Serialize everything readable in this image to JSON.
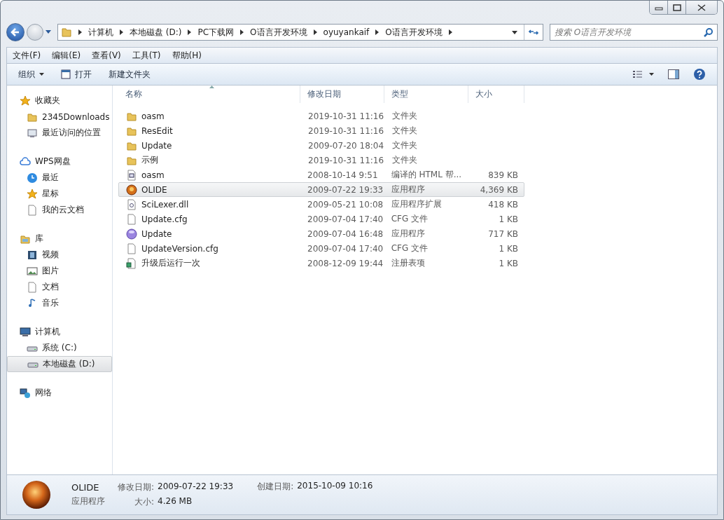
{
  "address_bar": {
    "breadcrumbs": [
      "计算机",
      "本地磁盘 (D:)",
      "PC下载网",
      "O语言开发环境",
      "oyuyankaif",
      "O语言开发环境"
    ]
  },
  "search": {
    "placeholder": "搜索 O语言开发环境"
  },
  "menu_bar": [
    "文件(F)",
    "编辑(E)",
    "查看(V)",
    "工具(T)",
    "帮助(H)"
  ],
  "toolbar": [
    {
      "kind": "dropdown",
      "label": "组织"
    },
    {
      "kind": "open",
      "label": "打开"
    },
    {
      "kind": "plain",
      "label": "新建文件夹"
    }
  ],
  "sidebar": {
    "groups": [
      {
        "label": "收藏夹",
        "kind": "star",
        "items": [
          {
            "label": "2345Downloads",
            "kind": "folder",
            "selected": false
          },
          {
            "label": "最近访问的位置",
            "kind": "recent",
            "selected": false
          }
        ]
      },
      {
        "label": "WPS网盘",
        "kind": "cloud",
        "items": [
          {
            "label": "最近",
            "kind": "clock",
            "selected": false
          },
          {
            "label": "星标",
            "kind": "star",
            "selected": false
          },
          {
            "label": "我的云文档",
            "kind": "blank",
            "selected": false
          }
        ]
      },
      {
        "label": "库",
        "kind": "library",
        "items": [
          {
            "label": "视频",
            "kind": "film",
            "selected": false
          },
          {
            "label": "图片",
            "kind": "picture",
            "selected": false
          },
          {
            "label": "文档",
            "kind": "blank",
            "selected": false
          },
          {
            "label": "音乐",
            "kind": "music",
            "selected": false
          }
        ]
      },
      {
        "label": "计算机",
        "kind": "computer",
        "items": [
          {
            "label": "系统 (C:)",
            "kind": "drive",
            "selected": false
          },
          {
            "label": "本地磁盘 (D:)",
            "kind": "drive",
            "selected": true
          }
        ]
      },
      {
        "label": "网络",
        "kind": "network"
      }
    ]
  },
  "table": {
    "columns": [
      "名称",
      "修改日期",
      "类型",
      "大小"
    ],
    "rows": [
      {
        "name": "oasm",
        "kind": "folder",
        "modified": "2019-10-31 11:16",
        "type": "文件夹",
        "selected": false
      },
      {
        "name": "ResEdit",
        "kind": "folder",
        "modified": "2019-10-31 11:16",
        "type": "文件夹",
        "selected": false
      },
      {
        "name": "Update",
        "kind": "folder",
        "modified": "2009-07-20 18:04",
        "type": "文件夹",
        "selected": false
      },
      {
        "name": "示例",
        "kind": "folder",
        "modified": "2019-10-31 11:16",
        "type": "文件夹",
        "selected": false
      },
      {
        "name": "oasm",
        "kind": "chm",
        "modified": "2008-10-14 9:51",
        "type": "编译的 HTML 帮...",
        "size": "839 KB",
        "selected": false
      },
      {
        "name": "OLIDE",
        "kind": "orange-app",
        "modified": "2009-07-22 19:33",
        "type": "应用程序",
        "size": "4,369 KB",
        "selected": true
      },
      {
        "name": "SciLexer.dll",
        "kind": "dll",
        "modified": "2009-05-21 10:08",
        "type": "应用程序扩展",
        "size": "418 KB",
        "selected": false
      },
      {
        "name": "Update.cfg",
        "kind": "blank",
        "modified": "2009-07-04 17:40",
        "type": "CFG 文件",
        "size": "1 KB",
        "selected": false
      },
      {
        "name": "Update",
        "kind": "purple-app",
        "modified": "2009-07-04 16:48",
        "type": "应用程序",
        "size": "717 KB",
        "selected": false
      },
      {
        "name": "UpdateVersion.cfg",
        "kind": "blank",
        "modified": "2009-07-04 17:40",
        "type": "CFG 文件",
        "size": "1 KB",
        "selected": false
      },
      {
        "name": "升级后运行一次",
        "kind": "reg",
        "modified": "2008-12-09 19:44",
        "type": "注册表项",
        "size": "1 KB",
        "selected": false
      }
    ]
  },
  "details": {
    "name": "OLIDE",
    "type": "应用程序",
    "modified_label": "修改日期:",
    "modified": "2009-07-22 19:33",
    "created_label": "创建日期:",
    "created": "2015-10-09 10:16",
    "size_label": "大小:",
    "size": "4.26 MB"
  }
}
